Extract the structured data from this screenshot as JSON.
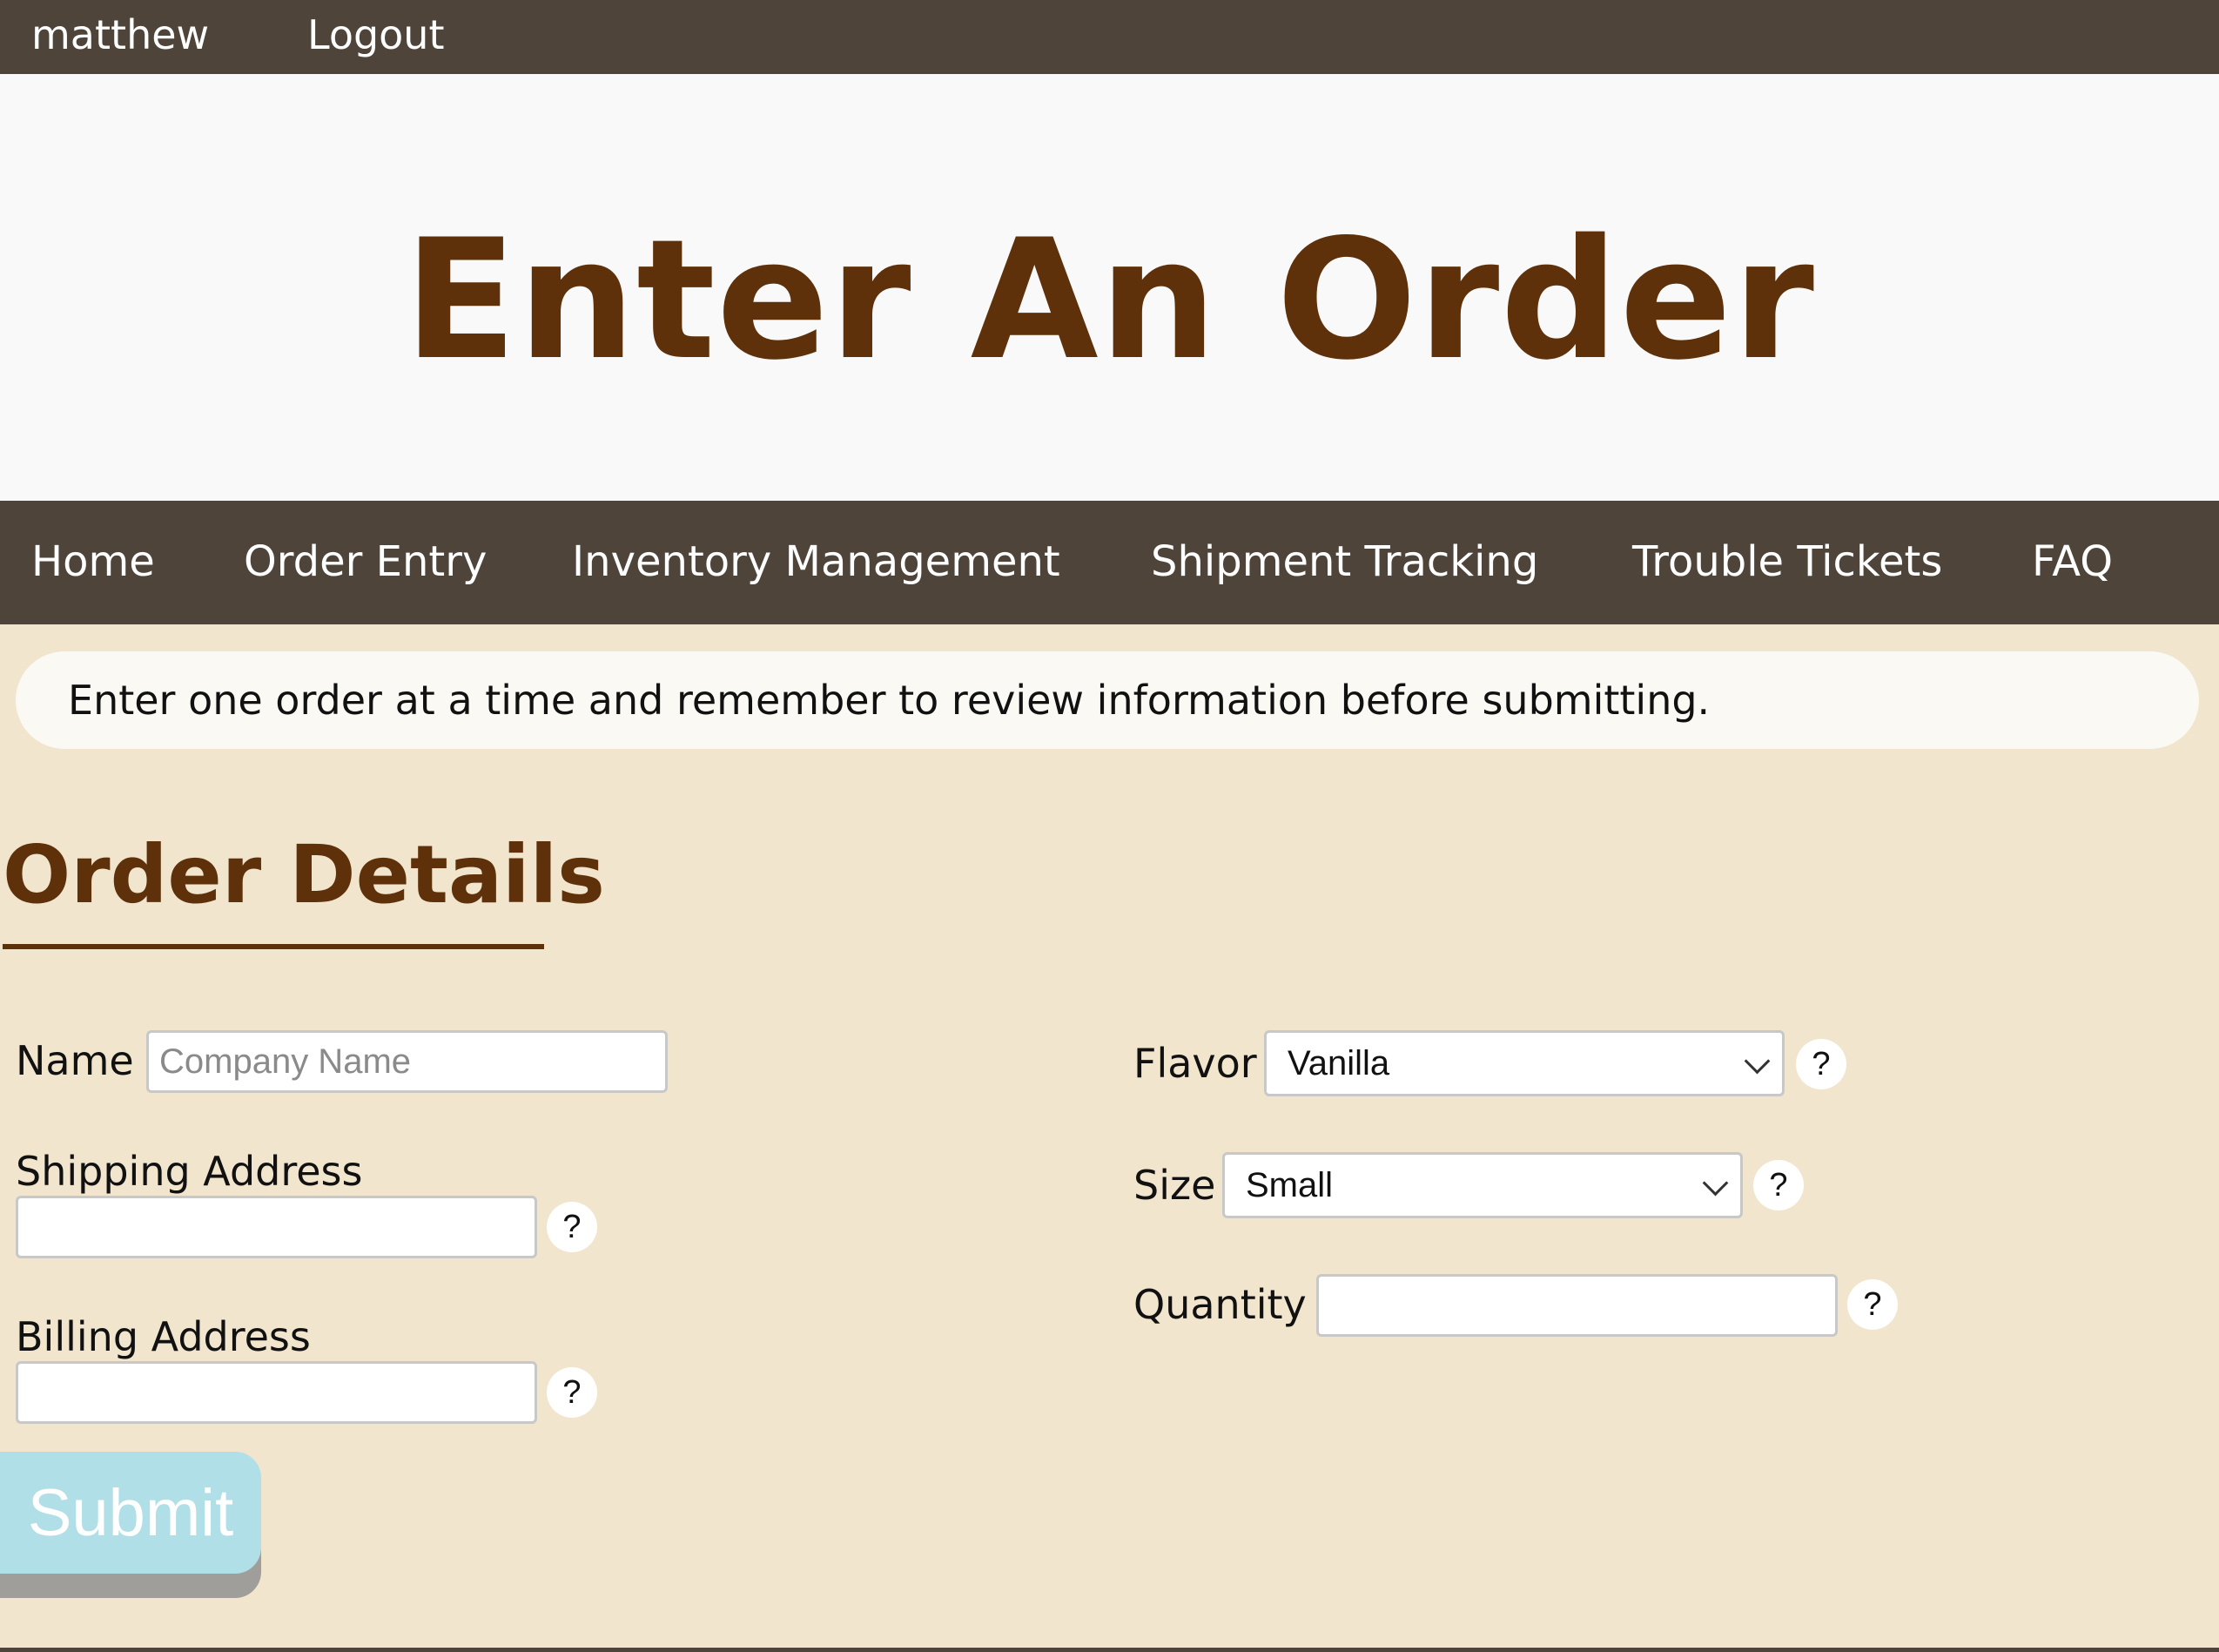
{
  "topbar": {
    "username": "matthew",
    "logout": "Logout"
  },
  "header": {
    "title": "Enter An Order"
  },
  "nav": {
    "home": "Home",
    "order_entry": "Order Entry",
    "inventory": "Inventory Management",
    "shipment": "Shipment Tracking",
    "tickets": "Trouble Tickets",
    "faq": "FAQ"
  },
  "notice": "Enter one order at a time and remember to review information before submitting.",
  "form": {
    "section_title": "Order Details",
    "name_label": "Name",
    "name_placeholder": "Company Name",
    "name_value": "",
    "shipping_label": "Shipping Address",
    "shipping_value": "",
    "billing_label": "Billing Address",
    "billing_value": "",
    "flavor_label": "Flavor",
    "flavor_value": "Vanilla",
    "size_label": "Size",
    "size_value": "Small",
    "quantity_label": "Quantity",
    "quantity_value": "",
    "help_text": "?",
    "submit_label": "Submit"
  },
  "colors": {
    "bar": "#4e443a",
    "heading": "#5e310a",
    "background": "#f1e5cd",
    "submit": "#b0dfe7"
  }
}
